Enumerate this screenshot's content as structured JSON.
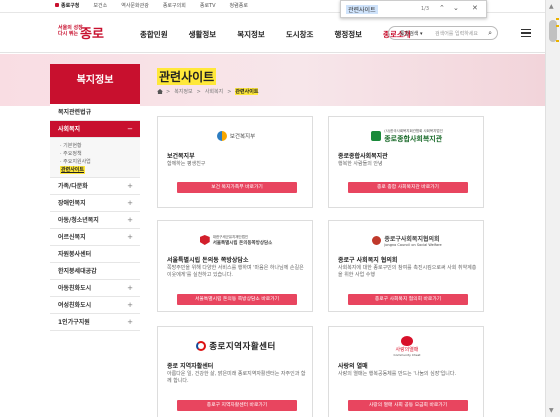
{
  "topbar": {
    "links": [
      "종로구청",
      "보건소",
      "역사문화관광",
      "종로구의회",
      "종로TV",
      "청렴종로"
    ]
  },
  "findbar": {
    "query": "관련사이트",
    "count": "1/3"
  },
  "header": {
    "logo_small": [
      "서울의 성장",
      "다시 뛰는"
    ],
    "logo_big": "종로",
    "nav": [
      "종합민원",
      "생활정보",
      "복지정보",
      "도시창조",
      "행정정보",
      "종로소개"
    ],
    "search_select": "통합검색",
    "search_placeholder": "검색어를 입력하세요"
  },
  "sidebar": {
    "title": "복지정보",
    "items": [
      {
        "label": "복지관련법규",
        "pm": ""
      },
      {
        "label": "사회복지",
        "pm": "−",
        "active": true
      },
      {
        "label": "가족/다문화",
        "pm": "+"
      },
      {
        "label": "장애인복지",
        "pm": "+"
      },
      {
        "label": "아동/청소년복지",
        "pm": "+"
      },
      {
        "label": "어르신복지",
        "pm": "+"
      },
      {
        "label": "자원봉사센터",
        "pm": ""
      },
      {
        "label": "한지붕세대공감",
        "pm": ""
      },
      {
        "label": "아동친화도시",
        "pm": "+"
      },
      {
        "label": "여성친화도시",
        "pm": "+"
      },
      {
        "label": "1인가구지원",
        "pm": "+"
      }
    ],
    "sub": [
      "· 기본현황",
      "· 주요정책",
      "· 주요지원사업",
      "관련사이트"
    ]
  },
  "content": {
    "title": "관련사이트",
    "breadcrumb": [
      "복지정보",
      "사회복지",
      "관련사이트"
    ],
    "cards": [
      {
        "logo": "보건복지부",
        "name": "보건복지부",
        "desc": "함께하는 평생친구",
        "btn": "보건 복지가족부 바로가기"
      },
      {
        "logo": "종로종합사회복지관",
        "logo_small": "(사)한국사회복지회관협회 사회복지법인",
        "name": "종로종합사회복지관",
        "desc": "행복한 사람들의 안녕",
        "btn": "종로 종합 사회복지관 바로가기"
      },
      {
        "logo": "서울특별시립 돈의동쪽방상담소",
        "logo_small": "대한구세군유지재단법인",
        "name": "서울특별시립 돈의동 쪽방상담소",
        "desc": "쪽방주민을 위해 다양한 서비스를 행하며 '마음은 하나님께 손길은 이웃에게'를 실천하고 있습니다.",
        "btn": "서울특별시립 돈의동 쪽방상담소 바로가기"
      },
      {
        "logo": "종로구사회복지협의회",
        "logo_small": "Jongno Council on Social Welfare",
        "name": "종로구 사회복지 협의회",
        "desc": "사회복지에 대한 종로구민의 참여를 촉진시킴으로써 사회 취약계층을 위한 사업 수행",
        "btn": "종로구 사회복지 협의회 바로가기"
      },
      {
        "logo": "종로지역자활센터",
        "name": "종로 지역자활센터",
        "desc": "아름다운 일, 건강한 삶, 밝은미래 종로지역자활센터는 자주인과 함께 합니다.",
        "btn": "종로구 지역자활센터 바로가기"
      },
      {
        "logo": "사랑의열매",
        "logo_small": "Community Chest",
        "name": "사랑의 열매",
        "desc": "사랑의 열매는 행복공동체를 만드는 '나눔의 심장'입니다.",
        "btn": "사랑의 열매 사회 공동 모금회 바로가기"
      }
    ]
  }
}
